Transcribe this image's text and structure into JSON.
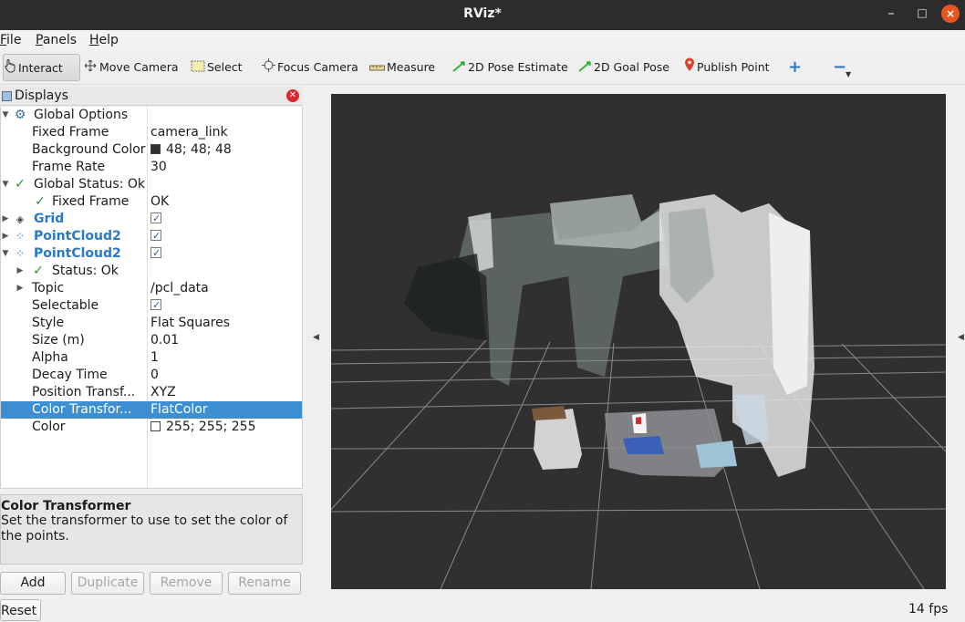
{
  "window": {
    "title": "RViz*",
    "controls": {
      "minimize": "–",
      "maximize": "□",
      "close": "×"
    }
  },
  "menubar": [
    "File",
    "Panels",
    "Help"
  ],
  "toolbar": {
    "interact": "Interact",
    "move_camera": "Move Camera",
    "select": "Select",
    "focus_camera": "Focus Camera",
    "measure": "Measure",
    "pose_estimate": "2D Pose Estimate",
    "goal_pose": "2D Goal Pose",
    "publish_point": "Publish Point",
    "add_tool": "+",
    "remove_tool": "−",
    "active_tool": "Interact"
  },
  "displays_panel": {
    "title": "Displays",
    "rows": [
      {
        "name": "Global Options",
        "value": "",
        "icon": "gear-icon"
      },
      {
        "name": "Fixed Frame",
        "value": "camera_link"
      },
      {
        "name": "Background Color",
        "value": "48; 48; 48",
        "swatch": "#303030"
      },
      {
        "name": "Frame Rate",
        "value": "30"
      },
      {
        "name": "Global Status: Ok",
        "value": "",
        "icon": "check-icon"
      },
      {
        "name": "Fixed Frame",
        "value": "OK",
        "icon": "check-icon"
      },
      {
        "name": "Grid",
        "value": "",
        "checked": true,
        "icon": "grid-icon"
      },
      {
        "name": "PointCloud2",
        "value": "",
        "checked": true,
        "icon": "pointcloud-icon"
      },
      {
        "name": "PointCloud2",
        "value": "",
        "checked": true,
        "icon": "pointcloud-icon"
      },
      {
        "name": "Status: Ok",
        "value": "",
        "icon": "check-icon"
      },
      {
        "name": "Topic",
        "value": "/pcl_data"
      },
      {
        "name": "Selectable",
        "value": "",
        "checked": true
      },
      {
        "name": "Style",
        "value": "Flat Squares"
      },
      {
        "name": "Size (m)",
        "value": "0.01"
      },
      {
        "name": "Alpha",
        "value": "1"
      },
      {
        "name": "Decay Time",
        "value": "0"
      },
      {
        "name": "Position Transf...",
        "value": "XYZ"
      },
      {
        "name": "Color Transfor...",
        "value": "FlatColor",
        "selected": true
      },
      {
        "name": "Color",
        "value": "255; 255; 255",
        "swatch": "#ffffff"
      }
    ],
    "description": {
      "title": "Color Transformer",
      "text": "Set the transformer to use to set the color of the points."
    },
    "buttons": {
      "add": "Add",
      "duplicate": "Duplicate",
      "remove": "Remove",
      "rename": "Rename"
    }
  },
  "reset_button": "Reset",
  "status": {
    "fps": "14 fps"
  },
  "colors": {
    "viewport_bg": "#303030",
    "selection": "#3d8fd1",
    "accent_blue": "#2a78c6",
    "close_orange": "#e95420"
  }
}
